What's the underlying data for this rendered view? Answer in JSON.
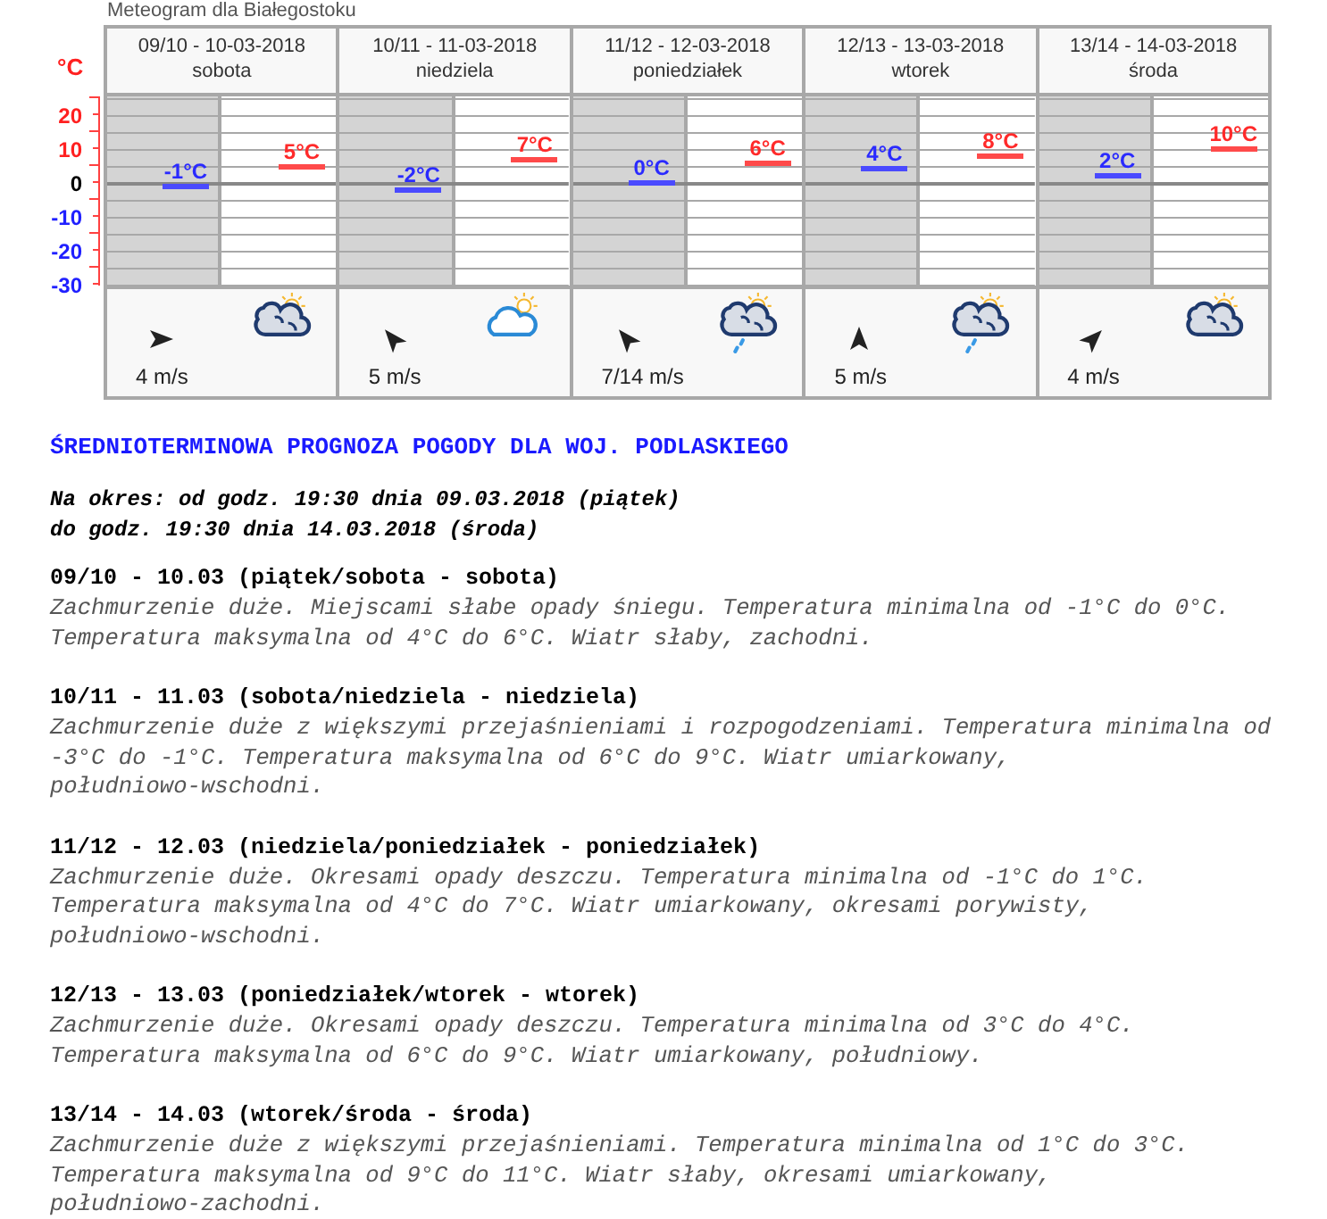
{
  "meteogram": {
    "title": "Meteogram dla Białegostoku",
    "unit": "°C",
    "axis": [
      "20",
      "10",
      "0",
      "-10",
      "-20",
      "-30"
    ],
    "days": [
      {
        "dates": "09/10 - 10-03-2018",
        "weekday": "sobota",
        "min": "-1°C",
        "max": "5°C",
        "wind_arrow": {
          "kind": "east"
        },
        "wind": "4 m/s",
        "weather_icon": {
          "kind": "cloudy"
        }
      },
      {
        "dates": "10/11 - 11-03-2018",
        "weekday": "niedziela",
        "min": "-2°C",
        "max": "7°C",
        "wind_arrow": {
          "kind": "northwest"
        },
        "wind": "5 m/s",
        "weather_icon": {
          "kind": "partly"
        }
      },
      {
        "dates": "11/12 - 12-03-2018",
        "weekday": "poniedziałek",
        "min": "0°C",
        "max": "6°C",
        "wind_arrow": {
          "kind": "northwest"
        },
        "wind": "7/14 m/s",
        "weather_icon": {
          "kind": "rain"
        }
      },
      {
        "dates": "12/13 - 13-03-2018",
        "weekday": "wtorek",
        "min": "4°C",
        "max": "8°C",
        "wind_arrow": {
          "kind": "north"
        },
        "wind": "5 m/s",
        "weather_icon": {
          "kind": "rain"
        }
      },
      {
        "dates": "13/14 - 14-03-2018",
        "weekday": "środa",
        "min": "2°C",
        "max": "10°C",
        "wind_arrow": {
          "kind": "northeast"
        },
        "wind": "4 m/s",
        "weather_icon": {
          "kind": "cloudy"
        }
      }
    ]
  },
  "forecast": {
    "heading": "ŚREDNIOTERMINOWA PROGNOZA POGODY DLA WOJ. PODLASKIEGO",
    "period": [
      "Na okres: od godz. 19:30 dnia 09.03.2018 (piątek)",
      "do godz. 19:30 dnia 14.03.2018 (środa)"
    ],
    "days": [
      {
        "title": "09/10 - 10.03 (piątek/sobota - sobota)",
        "text": "Zachmurzenie duże. Miejscami słabe opady śniegu. Temperatura minimalna od -1°C do 0°C. Temperatura maksymalna od 4°C do 6°C. Wiatr słaby, zachodni."
      },
      {
        "title": "10/11 - 11.03 (sobota/niedziela - niedziela)",
        "text": "Zachmurzenie duże z większymi przejaśnieniami i rozpogodzeniami. Temperatura minimalna od -3°C do -1°C. Temperatura maksymalna od 6°C do 9°C. Wiatr umiarkowany, południowo-wschodni."
      },
      {
        "title": "11/12 - 12.03 (niedziela/poniedziałek - poniedziałek)",
        "text": "Zachmurzenie duże. Okresami opady deszczu. Temperatura minimalna od -1°C do 1°C. Temperatura maksymalna od 4°C do 7°C. Wiatr umiarkowany, okresami porywisty, południowo-wschodni."
      },
      {
        "title": "12/13 - 13.03 (poniedziałek/wtorek - wtorek)",
        "text": "Zachmurzenie duże. Okresami opady deszczu. Temperatura minimalna od 3°C do 4°C. Temperatura maksymalna od 6°C do 9°C. Wiatr umiarkowany, południowy."
      },
      {
        "title": "13/14 - 14.03 (wtorek/środa - środa)",
        "text": "Zachmurzenie duże z większymi przejaśnieniami. Temperatura minimalna od 1°C do 3°C. Temperatura maksymalna od 9°C do 11°C. Wiatr słaby, okresami umiarkowany, południowo-zachodni."
      }
    ]
  }
}
